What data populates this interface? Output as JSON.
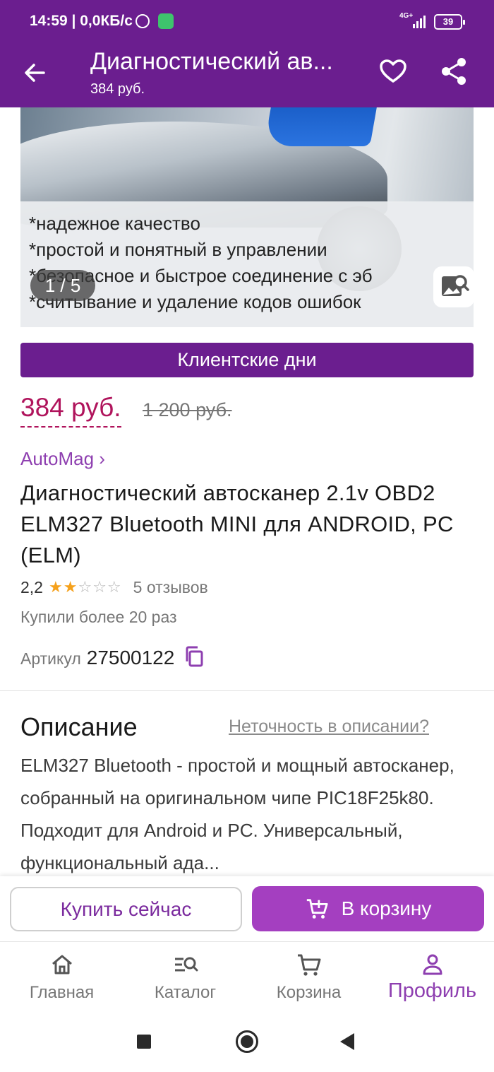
{
  "status_bar": {
    "time": "14:59 | 0,0КБ/с",
    "network": "4G+",
    "battery": "39"
  },
  "app_bar": {
    "title": "Диагностический ав...",
    "subtitle": "384 руб."
  },
  "gallery": {
    "features": [
      "*надежное качество",
      "*простой и понятный в управлении",
      "*безопасное и быстрое соединение с эб",
      "*считывание и удаление кодов ошибок"
    ],
    "counter": "1 / 5"
  },
  "promo": {
    "label": "Клиентские дни"
  },
  "price": {
    "current": "384 руб.",
    "old": "1 200 руб."
  },
  "seller": {
    "name": "AutoMag ›"
  },
  "product": {
    "title": "Диагностический автосканер 2.1v OBD2 ELM327 Bluetooth MINI для ANDROID, PC (ELM)",
    "rating": "2,2",
    "rating_stars": 2,
    "max_stars": 5,
    "reviews": "5 отзывов",
    "bought": "Купили более 20 раз",
    "article_label": "Артикул",
    "article_number": "27500122"
  },
  "description": {
    "heading": "Описание",
    "report_link": "Неточность в описании?",
    "text": "ELM327 Bluetooth - простой и мощный автосканер, собранный на оригинальном чипе PIC18F25k80. Подходит для Android и PC. Универсальный, функциональный ада..."
  },
  "actions": {
    "buy_now": "Купить сейчас",
    "to_cart": "В корзину"
  },
  "bottom_nav": {
    "items": [
      {
        "label": "Главная",
        "icon": "home-icon"
      },
      {
        "label": "Каталог",
        "icon": "catalog-search-icon"
      },
      {
        "label": "Корзина",
        "icon": "cart-icon"
      },
      {
        "label": "Профиль",
        "icon": "profile-icon"
      }
    ],
    "active": 3
  },
  "colors": {
    "brand": "#6b1e8f",
    "accent": "#a43fc0",
    "price": "#b0145c",
    "star": "#f5a11c"
  }
}
